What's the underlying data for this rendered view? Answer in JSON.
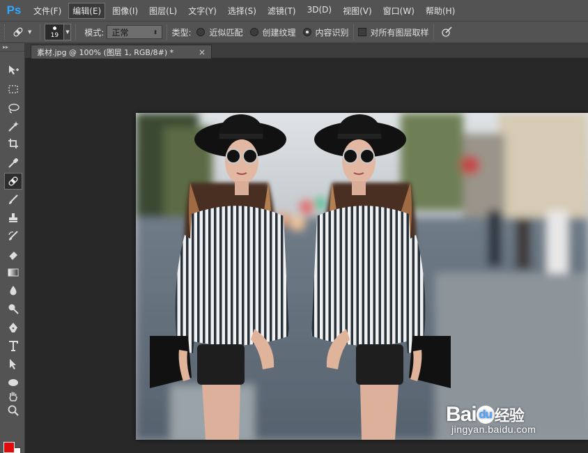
{
  "app": {
    "logo": "Ps"
  },
  "menu": [
    {
      "label": "文件(F)"
    },
    {
      "label": "编辑(E)",
      "active": true
    },
    {
      "label": "图像(I)"
    },
    {
      "label": "图层(L)"
    },
    {
      "label": "文字(Y)"
    },
    {
      "label": "选择(S)"
    },
    {
      "label": "滤镜(T)"
    },
    {
      "label": "3D(D)"
    },
    {
      "label": "视图(V)"
    },
    {
      "label": "窗口(W)"
    },
    {
      "label": "帮助(H)"
    }
  ],
  "options": {
    "brush_size": "19",
    "mode_label": "模式:",
    "mode_value": "正常",
    "type_label": "类型:",
    "radio_proximity": "近似匹配",
    "radio_texture": "创建纹理",
    "radio_content_aware": "内容识别",
    "selected_type": "内容识别",
    "sample_all_layers": "对所有图层取样",
    "sample_all_layers_checked": false
  },
  "document": {
    "tab_title": "素材.jpg @ 100% (图层 1, RGB/8#) *",
    "close_glyph": "×"
  },
  "tools": [
    "move-tool-icon",
    "marquee-tool-icon",
    "lasso-tool-icon",
    "magic-wand-tool-icon",
    "crop-tool-icon",
    "eyedropper-tool-icon",
    "spot-healing-brush-tool-icon",
    "brush-tool-icon",
    "clone-stamp-tool-icon",
    "history-brush-tool-icon",
    "eraser-tool-icon",
    "gradient-tool-icon",
    "blur-tool-icon",
    "dodge-tool-icon",
    "pen-tool-icon",
    "type-tool-icon",
    "path-selection-tool-icon",
    "ellipse-tool-icon",
    "hand-tool-icon",
    "zoom-tool-icon"
  ],
  "selected_tool": "spot-healing-brush-tool-icon",
  "colors": {
    "foreground": "#e20b0b",
    "background": "#ffffff",
    "accent": "#31a8ff"
  },
  "watermark": {
    "brand_left": "Bai",
    "brand_paw": "du",
    "brand_right": "经验",
    "url": "jingyan.baidu.com"
  }
}
